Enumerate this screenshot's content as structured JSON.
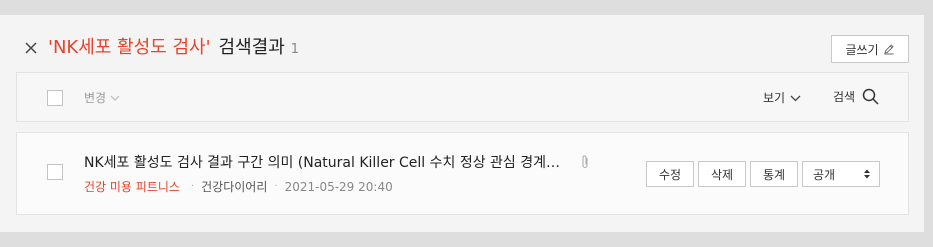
{
  "header": {
    "keyword": "'NK세포 활성도 검사'",
    "title_suffix": "검색결과",
    "result_count": "1",
    "write_label": "글쓰기"
  },
  "toolbar": {
    "change_label": "변경",
    "view_label": "보기",
    "search_label": "검색"
  },
  "posts": [
    {
      "title": "NK세포 활성도 검사 결과 구간 의미 (Natural Killer Cell 수치 정상 관심 경계 이상)",
      "category": "건강 미용 피트니스",
      "author": "건강다이어리",
      "date": "2021-05-29 20:40",
      "actions": {
        "edit": "수정",
        "delete": "삭제",
        "stats": "통계",
        "visibility": "공개"
      }
    }
  ],
  "icons": {
    "close": "close-icon",
    "write": "pencil-icon",
    "change": "chevron-down-icon",
    "view": "chevron-down-icon",
    "search": "search-icon",
    "attach": "paperclip-icon",
    "select": "select-arrows-icon"
  },
  "colors": {
    "accent": "#e8432c"
  }
}
